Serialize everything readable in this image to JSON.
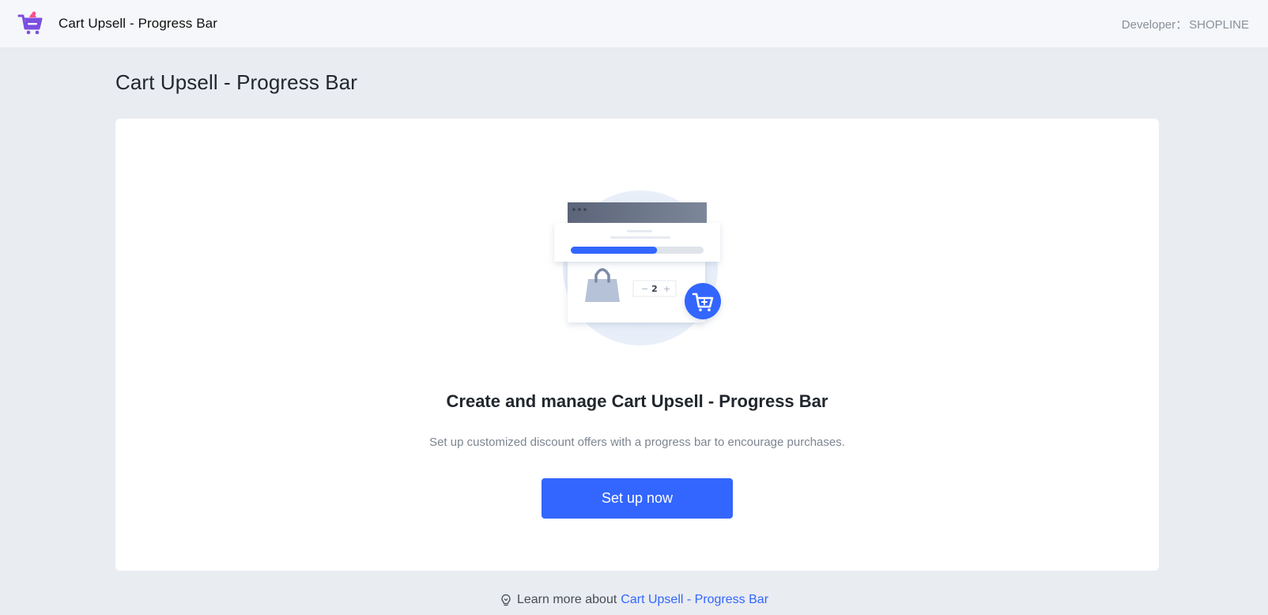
{
  "header": {
    "app_name": "Cart Upsell - Progress Bar",
    "developer_label": "Developer：",
    "developer_name": "SHOPLINE",
    "logo_icon": "cart-app-logo-icon"
  },
  "main": {
    "page_title": "Cart Upsell - Progress Bar",
    "empty_state": {
      "illustration_icon": "cart-progress-illustration",
      "quantity": "2",
      "progress_fraction": 0.65,
      "title": "Create and manage Cart Upsell - Progress Bar",
      "description": "Set up customized discount offers with a progress bar to encourage purchases.",
      "cta_label": "Set up now"
    }
  },
  "footer": {
    "learn_prefix": "Learn more about",
    "learn_link": "Cart Upsell - Progress Bar",
    "learn_icon": "lightbulb-icon"
  },
  "colors": {
    "accent": "#3366ff",
    "background": "#e9ecf1",
    "header_bg": "#f5f7fa",
    "logo_purple": "#7b4fe0",
    "logo_pink": "#ff4f8b"
  }
}
